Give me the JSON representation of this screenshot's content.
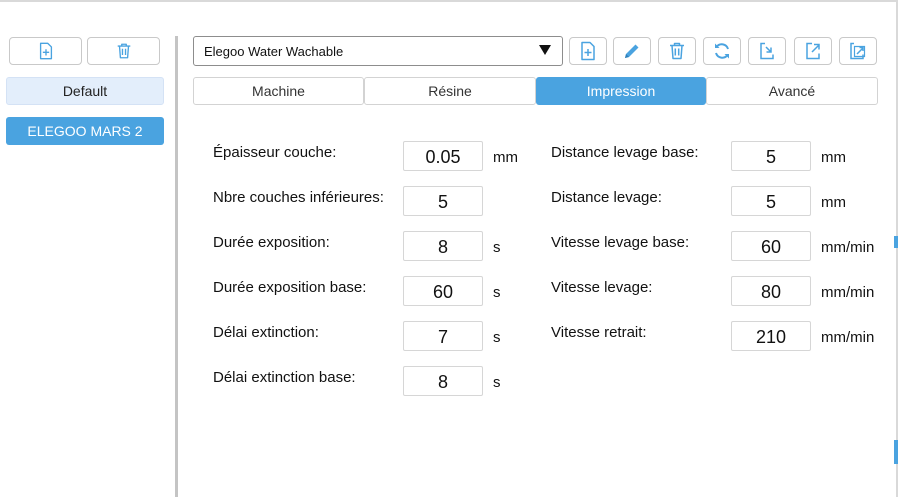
{
  "sidebar": {
    "profiles": [
      "Default",
      "ELEGOO MARS 2"
    ],
    "selected_profile": "ELEGOO MARS 2"
  },
  "toolbar": {
    "resin_selected": "Elegoo Water Wachable"
  },
  "tabs": [
    {
      "label": "Machine",
      "active": false
    },
    {
      "label": "Résine",
      "active": false
    },
    {
      "label": "Impression",
      "active": true
    },
    {
      "label": "Avancé",
      "active": false
    }
  ],
  "form": {
    "left": [
      {
        "label": "Épaisseur couche:",
        "value": "0.05",
        "unit": "mm"
      },
      {
        "label": "Nbre couches inférieures:",
        "value": "5",
        "unit": ""
      },
      {
        "label": "Durée exposition:",
        "value": "8",
        "unit": "s"
      },
      {
        "label": "Durée exposition base:",
        "value": "60",
        "unit": "s"
      },
      {
        "label": "Délai extinction:",
        "value": "7",
        "unit": "s"
      },
      {
        "label": "Délai extinction base:",
        "value": "8",
        "unit": "s"
      }
    ],
    "right": [
      {
        "label": "Distance levage base:",
        "value": "5",
        "unit": "mm"
      },
      {
        "label": "Distance levage:",
        "value": "5",
        "unit": "mm"
      },
      {
        "label": "Vitesse levage base:",
        "value": "60",
        "unit": "mm/min"
      },
      {
        "label": "Vitesse levage:",
        "value": "80",
        "unit": "mm/min"
      },
      {
        "label": "Vitesse retrait:",
        "value": "210",
        "unit": "mm/min"
      }
    ]
  },
  "colors": {
    "accent": "#4aa3e0",
    "selected_light": "#e3eefb",
    "border": "#c9c9c9"
  }
}
